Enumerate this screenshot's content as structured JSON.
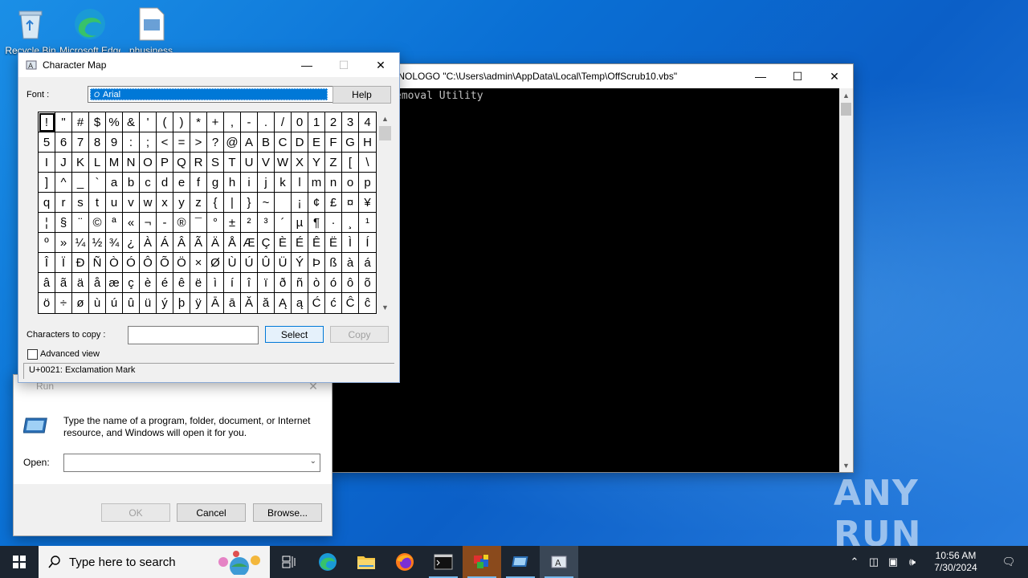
{
  "desktop": {
    "icons": [
      {
        "label": "Recycle Bin"
      },
      {
        "label": "Microsoft Edge"
      },
      {
        "label": "phusiness"
      }
    ]
  },
  "console": {
    "title": "/NOLOGO \"C:\\Users\\admin\\AppData\\Local\\Temp\\OffScrub10.vbs\"",
    "lines": [
      "emoval Utility"
    ]
  },
  "run": {
    "title": "Run",
    "description": "Type the name of a program, folder, document, or Internet resource, and Windows will open it for you.",
    "open_label": "Open:",
    "open_value": "",
    "ok_label": "OK",
    "cancel_label": "Cancel",
    "browse_label": "Browse..."
  },
  "charmap": {
    "title": "Character Map",
    "font_label": "Font :",
    "font_value": "Arial",
    "help_label": "Help",
    "chars_to_copy_label": "Characters to copy :",
    "chars_to_copy_value": "",
    "select_label": "Select",
    "copy_label": "Copy",
    "advanced_label": "Advanced view",
    "advanced_checked": false,
    "status": "U+0021: Exclamation Mark",
    "grid": [
      "!",
      "\"",
      "#",
      "$",
      "%",
      "&",
      "'",
      "(",
      ")",
      "*",
      "+",
      ",",
      "-",
      ".",
      "/",
      "0",
      "1",
      "2",
      "3",
      "4",
      "5",
      "6",
      "7",
      "8",
      "9",
      ":",
      ";",
      "<",
      "=",
      ">",
      "?",
      "@",
      "A",
      "B",
      "C",
      "D",
      "E",
      "F",
      "G",
      "H",
      "I",
      "J",
      "K",
      "L",
      "M",
      "N",
      "O",
      "P",
      "Q",
      "R",
      "S",
      "T",
      "U",
      "V",
      "W",
      "X",
      "Y",
      "Z",
      "[",
      "\\",
      "]",
      "^",
      "_",
      "`",
      "a",
      "b",
      "c",
      "d",
      "e",
      "f",
      "g",
      "h",
      "i",
      "j",
      "k",
      "l",
      "m",
      "n",
      "o",
      "p",
      "q",
      "r",
      "s",
      "t",
      "u",
      "v",
      "w",
      "x",
      "y",
      "z",
      "{",
      "|",
      "}",
      "~",
      " ",
      "¡",
      "¢",
      "£",
      "¤",
      "¥",
      "¦",
      "§",
      "¨",
      "©",
      "ª",
      "«",
      "¬",
      "-",
      "®",
      "¯",
      "°",
      "±",
      "²",
      "³",
      "´",
      "µ",
      "¶",
      "·",
      "¸",
      "¹",
      "º",
      "»",
      "¼",
      "½",
      "¾",
      "¿",
      "À",
      "Á",
      "Â",
      "Ã",
      "Ä",
      "Å",
      "Æ",
      "Ç",
      "È",
      "É",
      "Ê",
      "Ë",
      "Ì",
      "Í",
      "Î",
      "Ï",
      "Ð",
      "Ñ",
      "Ò",
      "Ó",
      "Ô",
      "Õ",
      "Ö",
      "×",
      "Ø",
      "Ù",
      "Ú",
      "Û",
      "Ü",
      "Ý",
      "Þ",
      "ß",
      "à",
      "á",
      "â",
      "ã",
      "ä",
      "å",
      "æ",
      "ç",
      "è",
      "é",
      "ê",
      "ë",
      "ì",
      "í",
      "î",
      "ï",
      "ð",
      "ñ",
      "ò",
      "ó",
      "ô",
      "õ",
      "ö",
      "÷",
      "ø",
      "ù",
      "ú",
      "û",
      "ü",
      "ý",
      "þ",
      "ÿ",
      "Ā",
      "ā",
      "Ă",
      "ă",
      "Ą",
      "ą",
      "Ć",
      "ć",
      "Ĉ",
      "ĉ"
    ]
  },
  "taskbar": {
    "search_placeholder": "Type here to search",
    "time": "10:56 AM",
    "date": "7/30/2024"
  },
  "watermark": "ANY RUN"
}
